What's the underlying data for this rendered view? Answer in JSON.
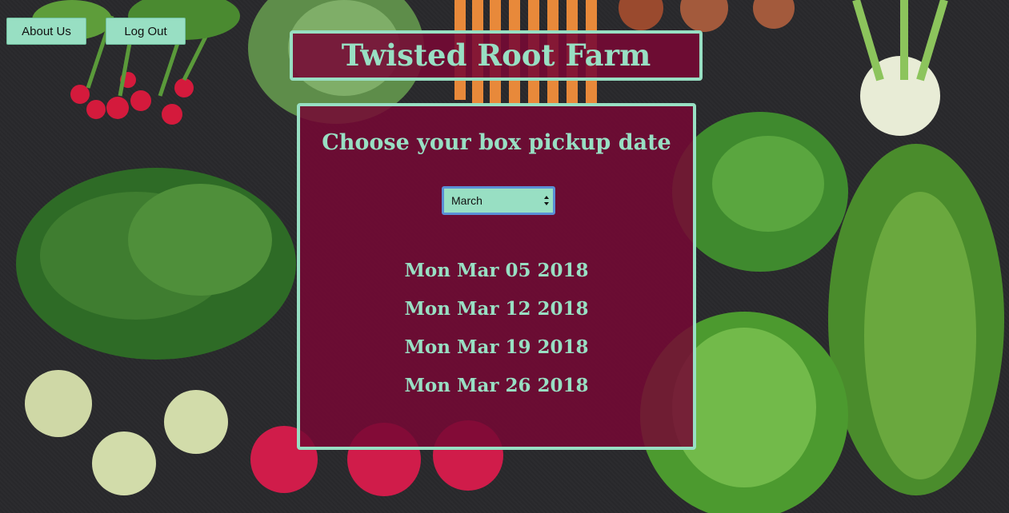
{
  "nav": {
    "about_label": "About Us",
    "logout_label": "Log Out"
  },
  "header": {
    "title": "Twisted Root Farm"
  },
  "main": {
    "heading": "Choose your box pickup date",
    "month_select": {
      "selected": "March"
    },
    "dates": [
      "Mon Mar 05 2018",
      "Mon Mar 12 2018",
      "Mon Mar 19 2018",
      "Mon Mar 26 2018"
    ]
  },
  "colors": {
    "accent": "#98dfc3",
    "panel": "#760834",
    "background": "#29292c"
  },
  "background_image": {
    "icon": "vegetables-photo"
  }
}
